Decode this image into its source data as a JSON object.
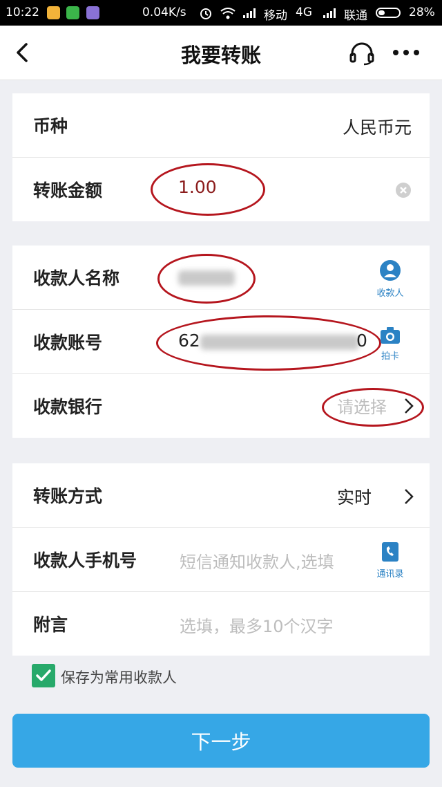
{
  "status_bar": {
    "time": "10:22",
    "speed": "0.04K/s",
    "carrier1": "移动",
    "network": "4G",
    "carrier2": "联通",
    "battery": "28%"
  },
  "nav": {
    "title": "我要转账",
    "back_icon": "chevron-left-icon",
    "service_icon": "headset-icon",
    "more_icon": "more-dots-icon"
  },
  "section1": {
    "currency_label": "币种",
    "currency_value": "人民币元",
    "amount_label": "转账金额",
    "amount_value": "1.00"
  },
  "section2": {
    "payee_name_label": "收款人名称",
    "payee_icon_label": "收款人",
    "account_label": "收款账号",
    "account_value_prefix": "62",
    "account_value_suffix": "0",
    "camera_icon_label": "拍卡",
    "bank_label": "收款银行",
    "bank_placeholder": "请选择"
  },
  "section3": {
    "method_label": "转账方式",
    "method_value": "实时",
    "phone_label": "收款人手机号",
    "phone_placeholder": "短信通知收款人,选填",
    "contacts_icon_label": "通讯录",
    "note_label": "附言",
    "note_placeholder": "选填，最多10个汉字"
  },
  "save_payee": {
    "checked": true,
    "label": "保存为常用收款人"
  },
  "next_button": "下一步",
  "colors": {
    "accent": "#36a7e6",
    "check": "#27a96a",
    "annotation": "#b5161e",
    "icon_blue": "#2b82c4"
  }
}
